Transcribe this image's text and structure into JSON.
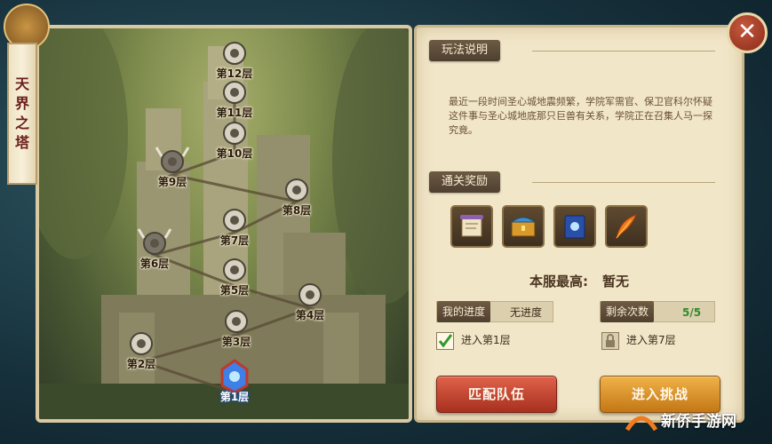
{
  "side_title": "天界之塔",
  "floors": [
    {
      "label": "第12层",
      "state": "locked"
    },
    {
      "label": "第11层",
      "state": "locked"
    },
    {
      "label": "第10层",
      "state": "locked"
    },
    {
      "label": "第9层",
      "state": "boss"
    },
    {
      "label": "第8层",
      "state": "locked"
    },
    {
      "label": "第7层",
      "state": "locked"
    },
    {
      "label": "第6层",
      "state": "boss"
    },
    {
      "label": "第5层",
      "state": "locked"
    },
    {
      "label": "第4层",
      "state": "locked"
    },
    {
      "label": "第3层",
      "state": "locked"
    },
    {
      "label": "第2层",
      "state": "locked"
    },
    {
      "label": "第1层",
      "state": "current"
    }
  ],
  "rules": {
    "heading": "玩法说明",
    "text": "最近一段时间圣心城地震频繁，学院军需官、保卫官科尔怀疑这件事与圣心城地底那只巨兽有关系，学院正在召集人马一探究竟。"
  },
  "rewards": {
    "heading": "通关奖励",
    "items": [
      "scroll-icon",
      "treasure-chest-icon",
      "spellbook-icon",
      "phoenix-feather-icon"
    ]
  },
  "server_best": {
    "label": "本服最高:",
    "value": "暂无"
  },
  "my_progress": {
    "label": "我的进度",
    "value": "无进度"
  },
  "remaining": {
    "label": "剩余次数",
    "value": "5/5"
  },
  "enter_current": {
    "label": "进入第1层",
    "checked": true
  },
  "enter_locked": {
    "label": "进入第7层",
    "locked": true
  },
  "buttons": {
    "match": "匹配队伍",
    "challenge": "进入挑战"
  },
  "watermark": "新侨手游网",
  "colors": {
    "accent_red": "#c2432e",
    "accent_gold": "#e0981f",
    "remaining_green": "#2f8a2a"
  }
}
